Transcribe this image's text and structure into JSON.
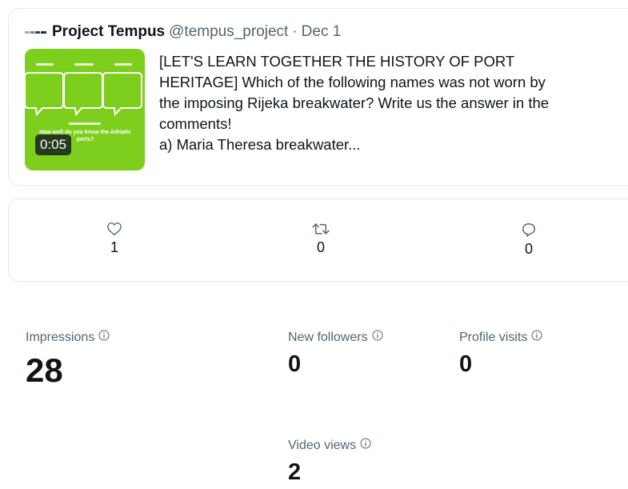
{
  "tweet": {
    "author_name": "Project Tempus",
    "handle": "@tempus_project",
    "separator": "·",
    "date": "Dec 1",
    "video_duration": "0:05",
    "thumbnail_caption": "How well do you know the Adriatic ports?",
    "text_lines": [
      "[LET'S LEARN TOGETHER THE HISTORY OF PORT",
      "HERITAGE] Which of the following names was not worn by",
      "the imposing Rijeka breakwater? Write us the answer in the",
      "comments!",
      "a) Maria Theresa breakwater..."
    ]
  },
  "engagement": {
    "likes": {
      "icon": "heart-icon",
      "value": "1"
    },
    "retweets": {
      "icon": "retweet-icon",
      "value": "0"
    },
    "replies": {
      "icon": "reply-icon",
      "value": "0"
    }
  },
  "stats": {
    "impressions": {
      "label": "Impressions",
      "value": "28"
    },
    "new_followers": {
      "label": "New followers",
      "value": "0"
    },
    "profile_visits": {
      "label": "Profile visits",
      "value": "0"
    },
    "video_views": {
      "label": "Video views",
      "value": "2"
    }
  },
  "colors": {
    "thumbnail_green": "#7dce1d",
    "muted_text": "#536471",
    "border": "#e6eaee"
  }
}
